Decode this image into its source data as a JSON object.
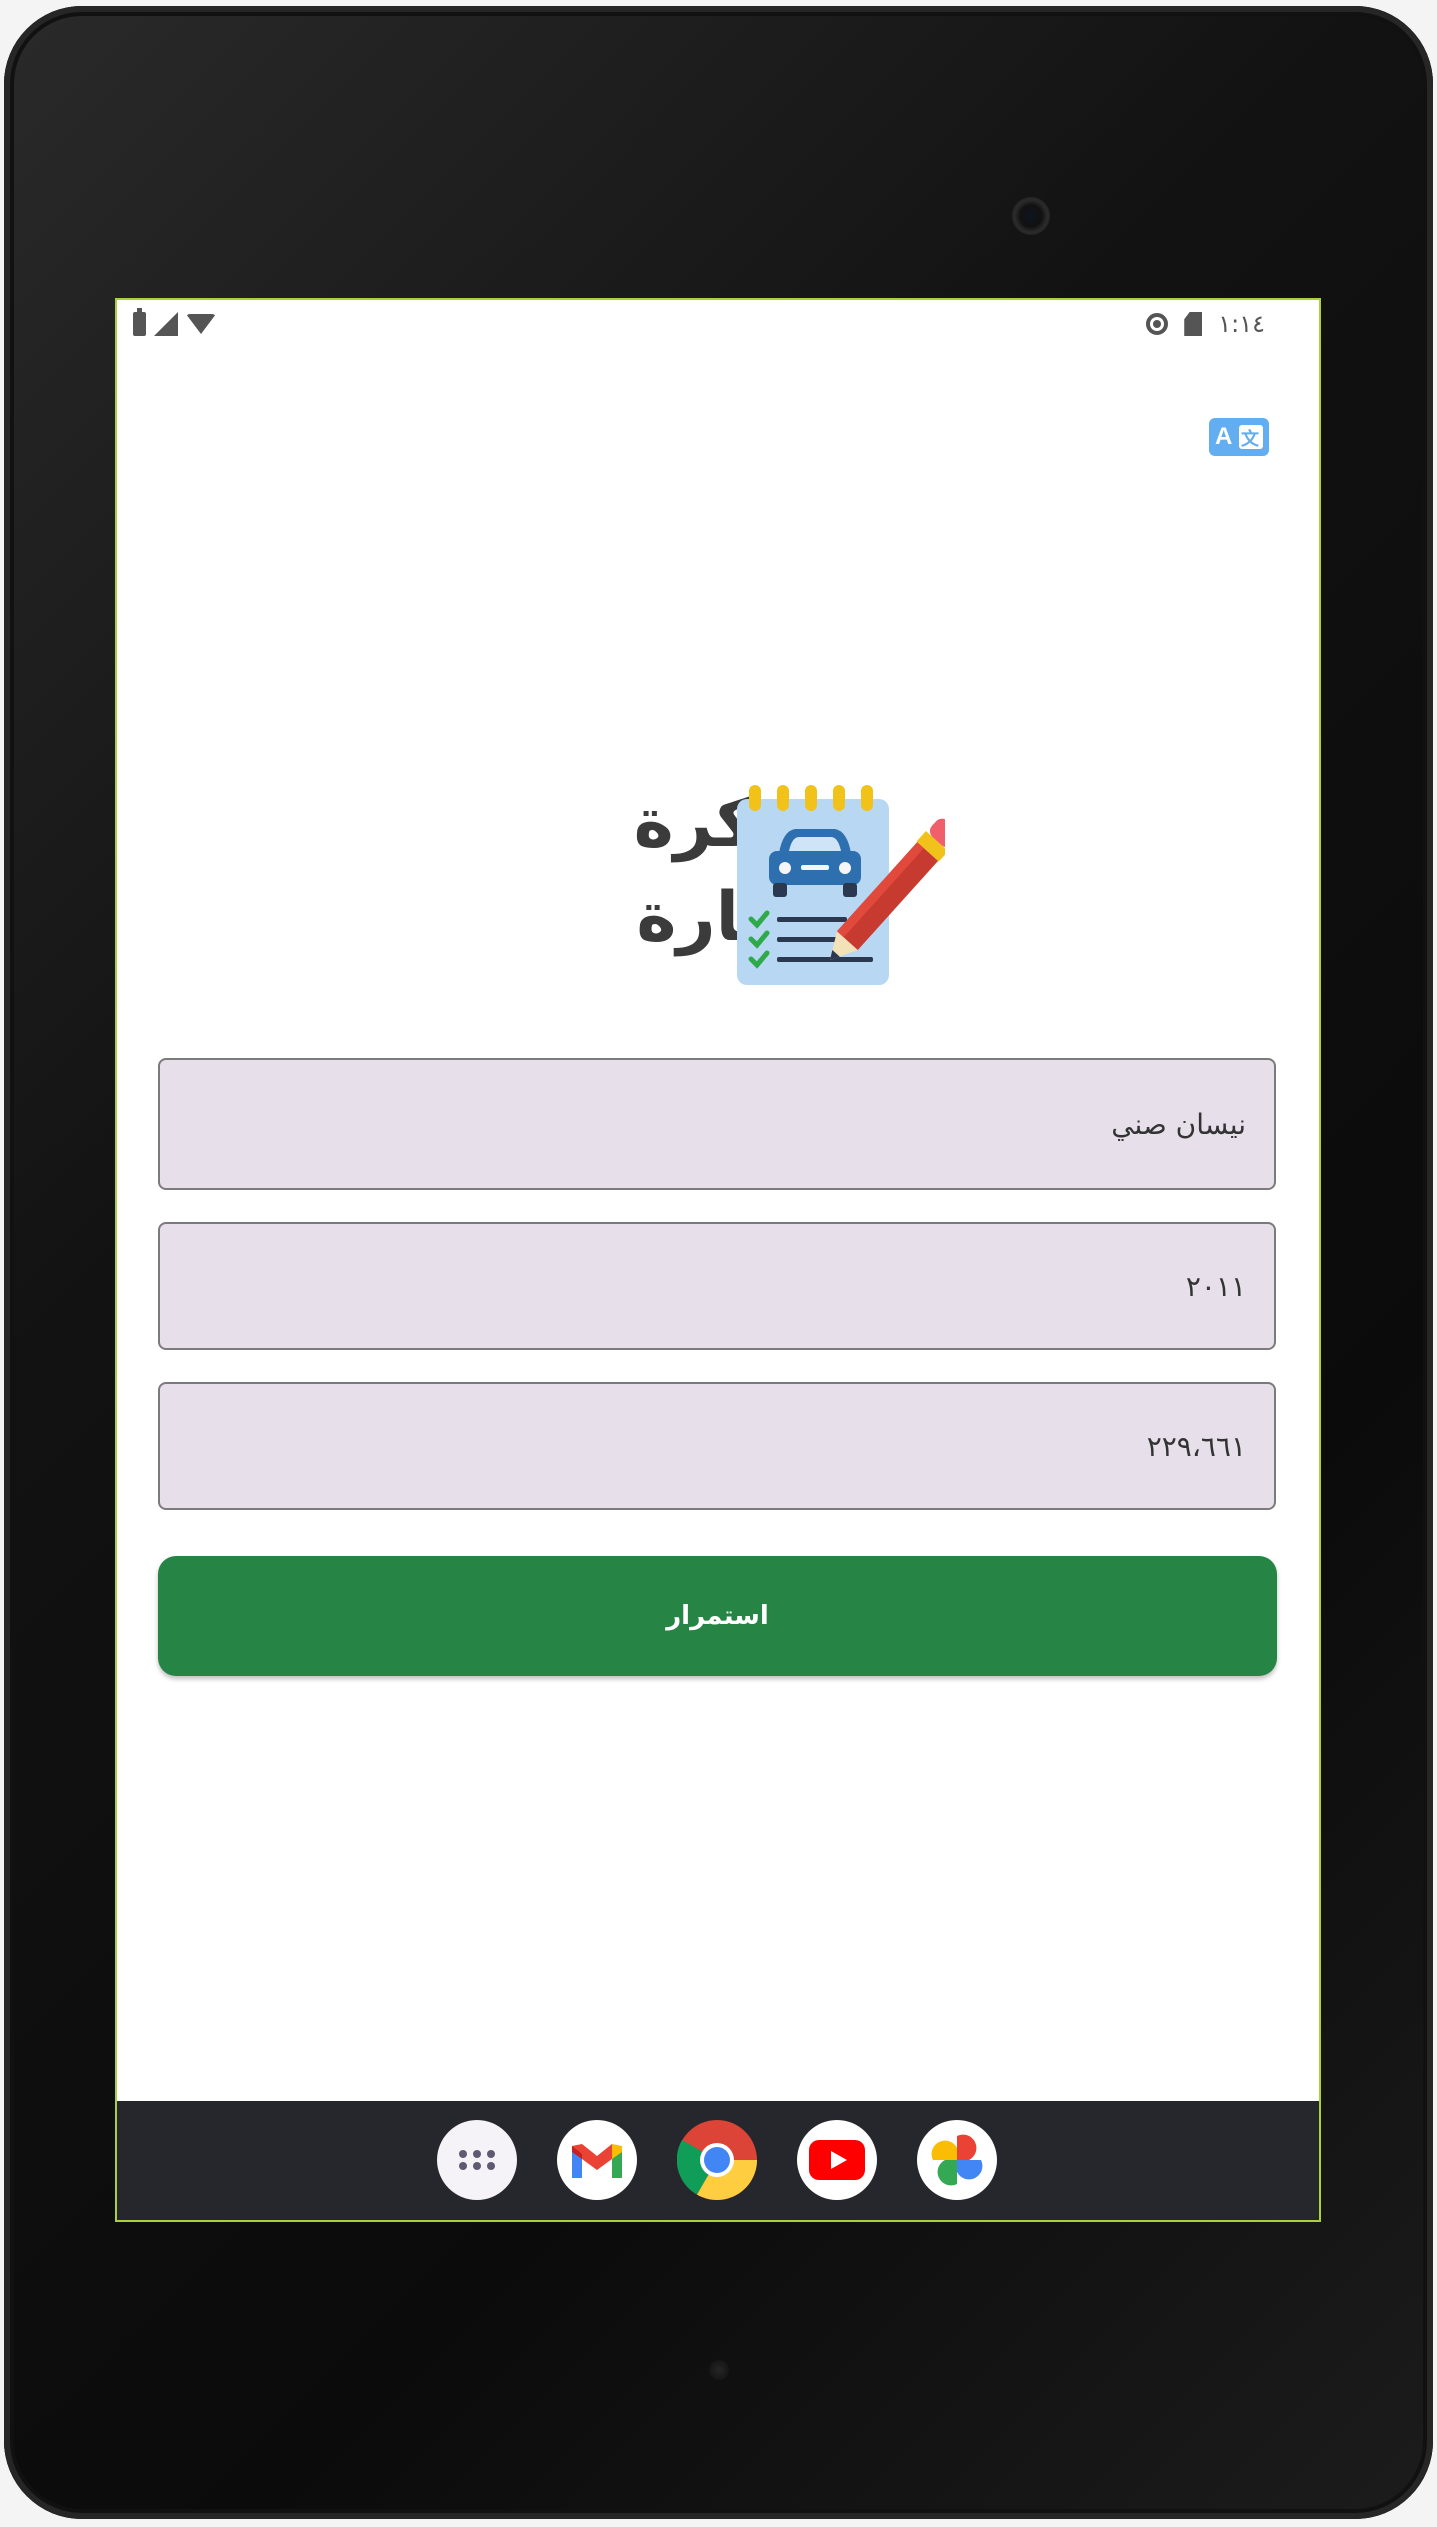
{
  "status_bar": {
    "time": "١:١٤",
    "icons": [
      "battery-icon",
      "signal-icon",
      "wifi-icon",
      "settings-icon",
      "sd-card-icon"
    ]
  },
  "toolbar": {
    "translate_icon": "translate-icon",
    "translate_letter": "A"
  },
  "header": {
    "title_line_1": "مذكرة",
    "title_line_2": "السيارة",
    "logo_icon": "car-notepad-pencil-icon"
  },
  "form": {
    "car_name_value": "نيسان صني",
    "year_value": "٢٠١١",
    "mileage_value": "٢٢٩،٦٦١",
    "continue_label": "استمرار"
  },
  "dock": {
    "apps": [
      "app-drawer-icon",
      "gmail-icon",
      "chrome-icon",
      "youtube-icon",
      "google-photos-icon"
    ]
  },
  "colors": {
    "accent_green": "#268545",
    "field_background": "#e7dfea",
    "translate_blue": "#62aef0",
    "dock_background": "#26272c"
  }
}
